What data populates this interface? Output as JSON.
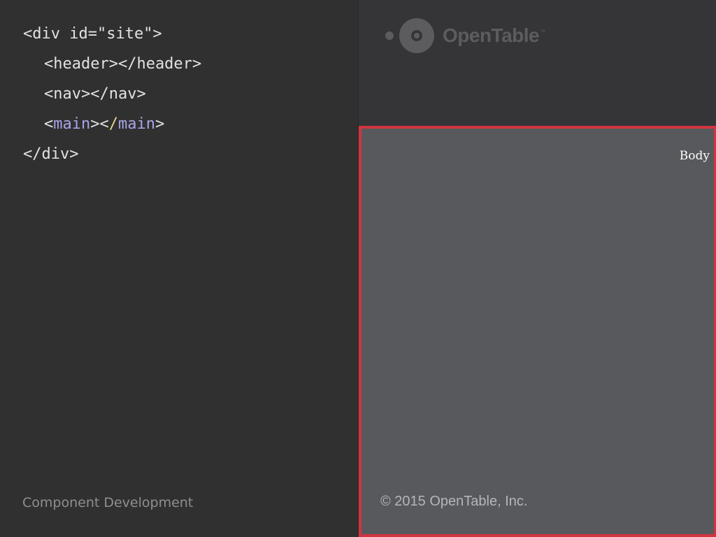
{
  "code": {
    "line1": "<div id=\"site\">",
    "line2": "<header></header>",
    "line3": "<nav></nav>",
    "line4": {
      "open_lt": "<",
      "open_tag": "main",
      "open_gt": ">",
      "close_lt": "<",
      "close_slash": "/",
      "close_tag": "main",
      "close_gt": ">"
    },
    "line5": "</div>"
  },
  "footer_label": "Component Development",
  "preview": {
    "logo": {
      "text": "OpenTable",
      "tm": "™"
    },
    "body_label": "Body",
    "copyright": "© 2015 OpenTable, Inc."
  },
  "colors": {
    "background": "#303030",
    "code_text": "#e2e2e2",
    "keyword": "#a9a4e6",
    "slash": "#e8d28a",
    "preview_header": "#353537",
    "body_fill": "#58595d",
    "body_border": "#d1353f",
    "logo": "#5c5c5f"
  }
}
